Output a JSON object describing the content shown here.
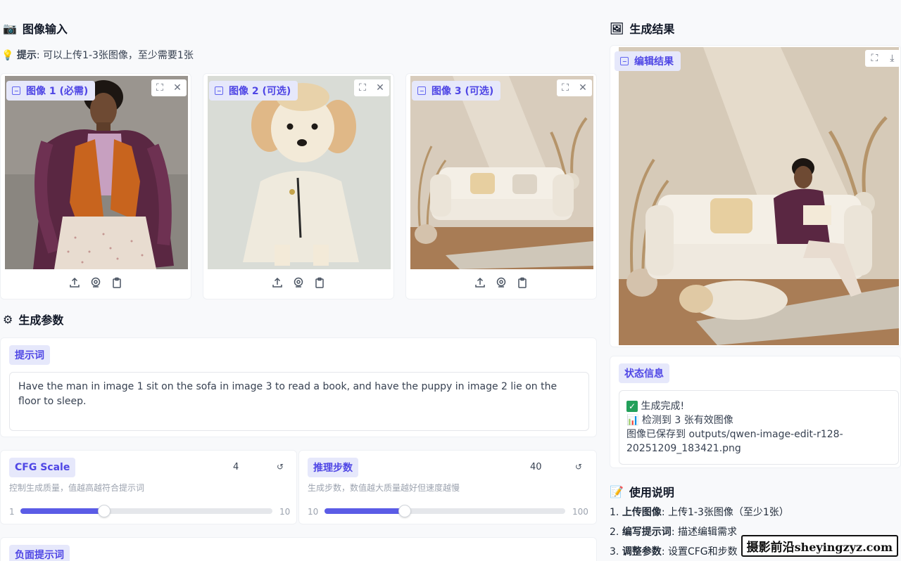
{
  "input": {
    "title": "图像输入",
    "hint_label": "提示",
    "hint_text": ": 可以上传1-3张图像，至少需要1张",
    "images": [
      {
        "label": "图像 1 (必需)"
      },
      {
        "label": "图像 2 (可选)"
      },
      {
        "label": "图像 3 (可选)"
      }
    ]
  },
  "params": {
    "title": "生成参数",
    "prompt_label": "提示词",
    "prompt_value": "Have the man in image 1 sit on the sofa in image 3 to read a book, and have the puppy in image 2 lie on the floor to sleep.",
    "cfg": {
      "label": "CFG Scale",
      "value": "4",
      "desc": "控制生成质量，值越高越符合提示词",
      "min": "1",
      "max": "10",
      "level": 0.333
    },
    "steps": {
      "label": "推理步数",
      "value": "40",
      "desc": "生成步数，数值越大质量越好但速度越慢",
      "min": "10",
      "max": "100",
      "level": 0.333
    },
    "negative_label": "负面提示词"
  },
  "result": {
    "title": "生成结果",
    "image_label": "编辑结果"
  },
  "status": {
    "label": "状态信息",
    "line1": "生成完成!",
    "line2": "检测到 3 张有效图像",
    "line3": "图像已保存到 outputs/qwen-image-edit-r128-",
    "line4": "20251209_183421.png"
  },
  "usage": {
    "title": "使用说明",
    "items": [
      {
        "num": "1.",
        "bold": "上传图像",
        "text": ": 上传1-3张图像（至少1张）"
      },
      {
        "num": "2.",
        "bold": "编写提示词",
        "text": ": 描述编辑需求"
      },
      {
        "num": "3.",
        "bold": "调整参数",
        "text": ": 设置CFG和步数"
      }
    ]
  },
  "watermark": {
    "cn": "摄影前沿",
    "site": "sheyingzyz.com"
  },
  "icons": {
    "camera": "camera-icon",
    "bulb": "lightbulb-icon",
    "gear": "gear-icon",
    "picture": "picture-icon",
    "memo": "memo-icon",
    "check": "check-icon",
    "chart": "bar-chart-icon"
  },
  "colors": {
    "accent": "#5b5ce6",
    "chip_bg": "#e6e8fb",
    "chip_text": "#4f46e5"
  }
}
